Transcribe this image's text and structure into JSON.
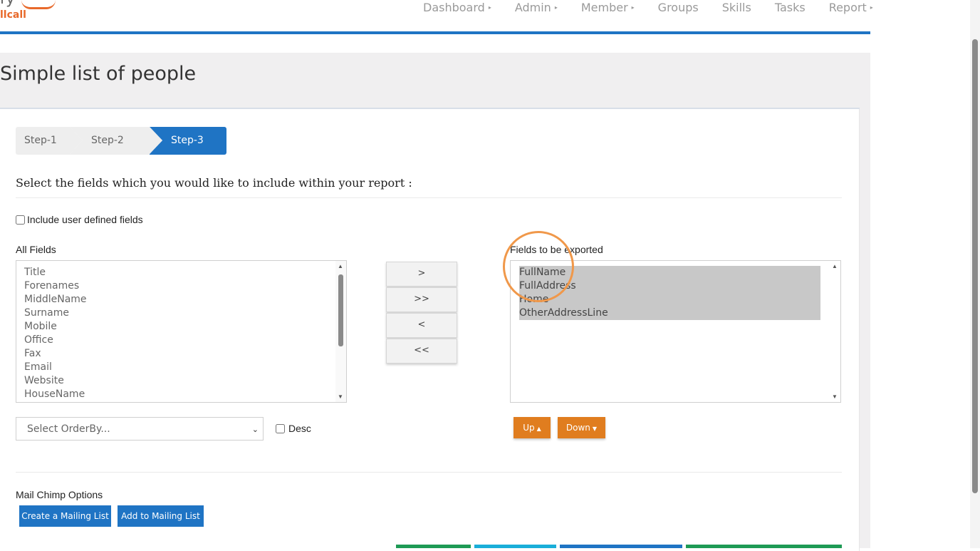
{
  "logo": {
    "top_fragment": "ry",
    "text": "llcall"
  },
  "nav": [
    {
      "label": "Dashboard",
      "caret": "▸"
    },
    {
      "label": "Admin",
      "caret": "▸"
    },
    {
      "label": "Member",
      "caret": "▸"
    },
    {
      "label": "Groups",
      "caret": ""
    },
    {
      "label": "Skills",
      "caret": ""
    },
    {
      "label": "Tasks",
      "caret": ""
    },
    {
      "label": "Report",
      "caret": "▸"
    }
  ],
  "page": {
    "title": "Simple list of people"
  },
  "steps": [
    "Step-1",
    "Step-2",
    "Step-3"
  ],
  "instruction": "Select the fields which you would like to include within your report :",
  "udf_label": "Include user defined fields",
  "all_fields": {
    "label": "All Fields",
    "items": [
      "Title",
      "Forenames",
      "MiddleName",
      "Surname",
      "Mobile",
      "Office",
      "Fax",
      "Email",
      "Website",
      "HouseName"
    ]
  },
  "export_fields": {
    "label": "Fields to be exported",
    "items": [
      "FullName",
      "FullAddress",
      "Home",
      "OtherAddressLine"
    ]
  },
  "move_buttons": {
    "add": ">",
    "add_all": ">>",
    "remove": "<",
    "remove_all": "<<"
  },
  "orderby": {
    "placeholder": "Select OrderBy..."
  },
  "desc_label": "Desc",
  "order_buttons": {
    "up": "Up",
    "down": "Down"
  },
  "mailchimp": {
    "title": "Mail Chimp Options",
    "create": "Create a Mailing List",
    "add": "Add to Mailing List"
  },
  "colors": {
    "accent_blue": "#1f74c4",
    "orange": "#e07d1f",
    "green": "#1e9a55",
    "cyan": "#1aaed9"
  }
}
